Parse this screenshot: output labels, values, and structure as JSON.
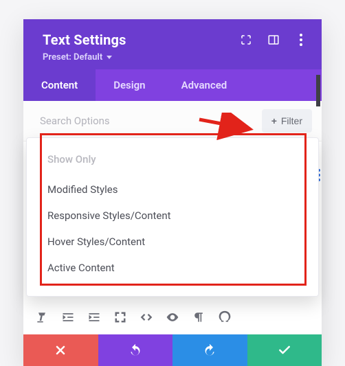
{
  "header": {
    "title": "Text Settings",
    "preset_label": "Preset: Default"
  },
  "tabs": {
    "content": "Content",
    "design": "Design",
    "advanced": "Advanced"
  },
  "search": {
    "placeholder": "Search Options",
    "filter_label": "Filter"
  },
  "filter_popover": {
    "heading": "Show Only",
    "items": [
      "Modified Styles",
      "Responsive Styles/Content",
      "Hover Styles/Content",
      "Active Content"
    ]
  }
}
